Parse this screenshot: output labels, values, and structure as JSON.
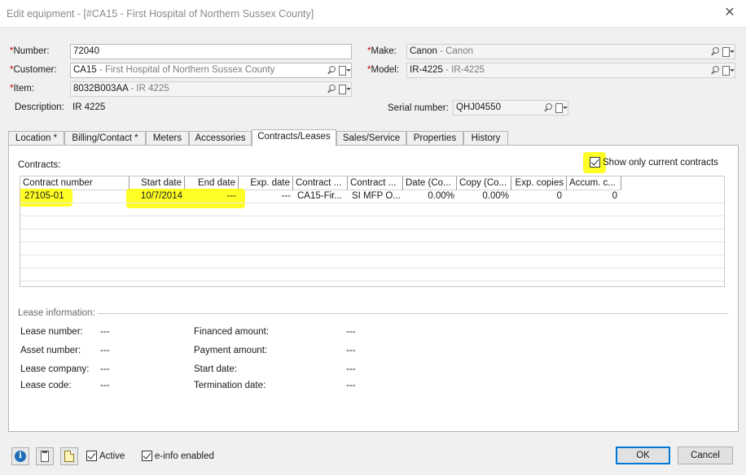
{
  "window": {
    "title": "Edit equipment - [#CA15 - First Hospital of Northern Sussex County]"
  },
  "form": {
    "number": {
      "label": "Number:",
      "value": "72040"
    },
    "customer": {
      "label": "Customer:",
      "code": "CA15",
      "name": " - First Hospital of Northern Sussex County"
    },
    "item": {
      "label": "Item:",
      "code": "8032B003AA",
      "name": " - IR 4225"
    },
    "description": {
      "label": "Description:",
      "value": "IR 4225"
    },
    "make": {
      "label": "Make:",
      "code": "Canon",
      "name": " - Canon"
    },
    "model": {
      "label": "Model:",
      "code": "IR-4225",
      "name": " - IR-4225"
    },
    "serial": {
      "label": "Serial number:",
      "value": "QHJ04550"
    },
    "required_marker": "*"
  },
  "tabs": [
    {
      "label": "Location *"
    },
    {
      "label": "Billing/Contact *"
    },
    {
      "label": "Meters"
    },
    {
      "label": "Accessories"
    },
    {
      "label": "Contracts/Leases"
    },
    {
      "label": "Sales/Service"
    },
    {
      "label": "Properties"
    },
    {
      "label": "History"
    }
  ],
  "contracts": {
    "label": "Contracts:",
    "show_current_label": "Show only current contracts",
    "show_current_checked": true,
    "columns": [
      "Contract number",
      "Start date",
      "End date",
      "Exp. date",
      "Contract ...",
      "Contract ...",
      "Date (Co...",
      "Copy (Co...",
      "Exp. copies",
      "Accum. c..."
    ],
    "rows": [
      [
        "27105-01",
        "10/7/2014",
        "---",
        "---",
        "CA15-Fir...",
        "SI MFP O...",
        "0.00%",
        "0.00%",
        "0",
        "0"
      ]
    ]
  },
  "lease": {
    "section_label": "Lease information:",
    "lease_number": {
      "label": "Lease number:",
      "value": "---"
    },
    "asset_number": {
      "label": "Asset number:",
      "value": "---"
    },
    "lease_company": {
      "label": "Lease company:",
      "value": "---"
    },
    "lease_code": {
      "label": "Lease code:",
      "value": "---"
    },
    "financed_amount": {
      "label": "Financed amount:",
      "value": "---"
    },
    "payment_amount": {
      "label": "Payment amount:",
      "value": "---"
    },
    "start_date": {
      "label": "Start date:",
      "value": "---"
    },
    "termination_date": {
      "label": "Termination date:",
      "value": "---"
    }
  },
  "footer": {
    "active_label": "Active",
    "active_checked": true,
    "einfo_label": "e-info enabled",
    "einfo_checked": true,
    "ok_label": "OK",
    "cancel_label": "Cancel"
  },
  "colors": {
    "highlight": "#ffff00",
    "required": "#c00000",
    "ok_border": "#0078d7"
  }
}
